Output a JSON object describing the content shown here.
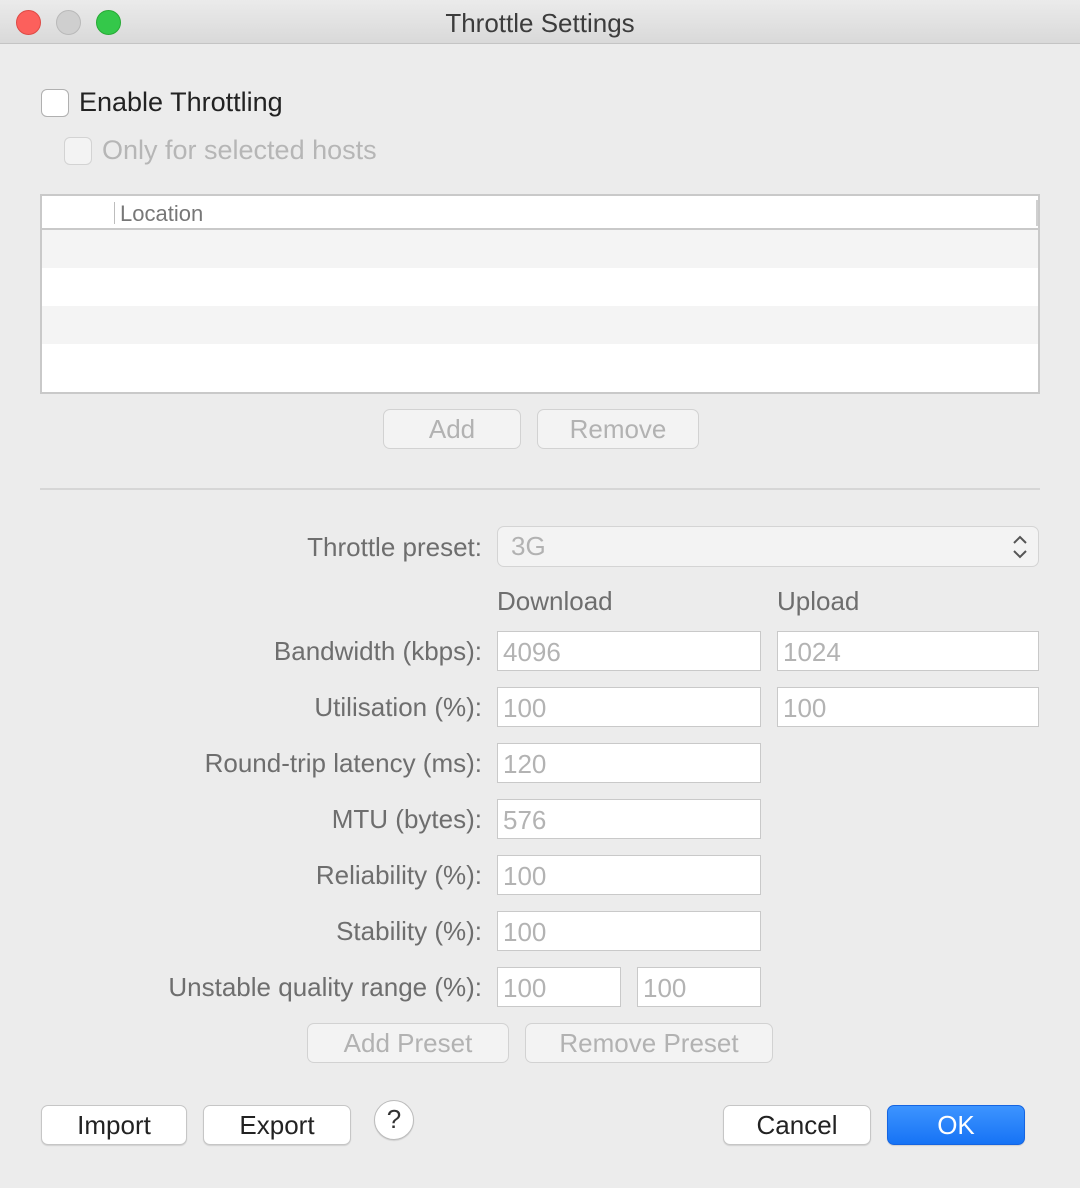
{
  "window": {
    "title": "Throttle Settings"
  },
  "enable_throttling": {
    "label": "Enable Throttling",
    "checked": false
  },
  "only_selected_hosts": {
    "label": "Only for selected hosts",
    "checked": false
  },
  "hosts_table": {
    "columns": [
      "",
      "Location"
    ],
    "rows": []
  },
  "host_buttons": {
    "add": "Add",
    "remove": "Remove"
  },
  "preset": {
    "label": "Throttle preset:",
    "value": "3G"
  },
  "columns": {
    "download": "Download",
    "upload": "Upload"
  },
  "fields": {
    "bandwidth": {
      "label": "Bandwidth (kbps):",
      "download": "4096",
      "upload": "1024"
    },
    "utilisation": {
      "label": "Utilisation (%):",
      "download": "100",
      "upload": "100"
    },
    "latency": {
      "label": "Round-trip latency (ms):",
      "value": "120"
    },
    "mtu": {
      "label": "MTU (bytes):",
      "value": "576"
    },
    "reliability": {
      "label": "Reliability (%):",
      "value": "100"
    },
    "stability": {
      "label": "Stability (%):",
      "value": "100"
    },
    "unstable_range": {
      "label": "Unstable quality range (%):",
      "min": "100",
      "max": "100"
    }
  },
  "preset_buttons": {
    "add": "Add Preset",
    "remove": "Remove Preset"
  },
  "footer": {
    "import": "Import",
    "export": "Export",
    "help": "?",
    "cancel": "Cancel",
    "ok": "OK"
  },
  "colors": {
    "accent": "#1a77f2",
    "close": "#fc605c",
    "zoom": "#34c84a",
    "disabled_text": "#b2b2b2"
  }
}
